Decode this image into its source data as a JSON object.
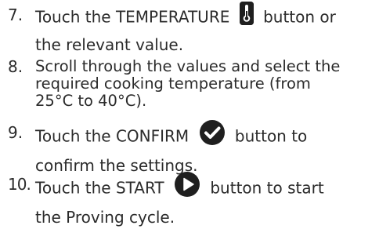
{
  "steps": [
    {
      "number": "7.",
      "text_before": "Touch the TEMPERATURE",
      "icon": "thermometer-icon",
      "text_after": "button or",
      "line2": "the relevant value."
    },
    {
      "number": "8.",
      "line1": "Scroll through the values and select the",
      "line2": "required cooking temperature (from",
      "line3": "25°C to 40°C)."
    },
    {
      "number": "9.",
      "text_before": "Touch the CONFIRM",
      "icon": "check-circle-icon",
      "text_after": "button to",
      "line2": "confirm the settings."
    },
    {
      "number": "10.",
      "text_before": "Touch the START",
      "icon": "play-circle-icon",
      "text_after": "button to start",
      "line2": "the Proving cycle."
    }
  ]
}
